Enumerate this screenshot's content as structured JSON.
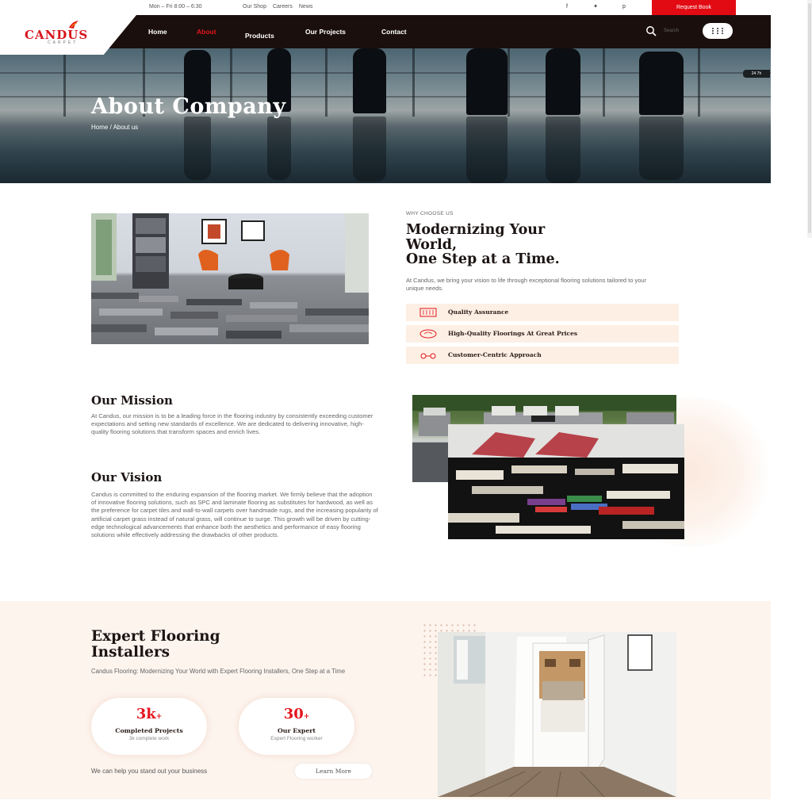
{
  "topbar": {
    "hours": "Mon – Fri 8:00 – 6:30",
    "links": [
      "Our Shop",
      "Careers",
      "News"
    ],
    "social_icons": [
      "facebook-icon",
      "twitter-icon",
      "pinterest-icon"
    ],
    "request_label": "Request Book"
  },
  "brand": {
    "name": "CANDUS",
    "tagline": "CARPET"
  },
  "nav": {
    "items": [
      "Home",
      "About",
      "Products",
      "Our Projects",
      "Contact"
    ],
    "active": "About",
    "search_placeholder": "Search"
  },
  "hero": {
    "title": "About Company",
    "breadcrumb": "Home / About us",
    "tag": "24 7h"
  },
  "why": {
    "eyebrow": "WHY CHOOSE US",
    "title_line1": "Modernizing Your",
    "title_line2": "World,",
    "title_line3": "One Step at a Time.",
    "description": "At Candus, we bring your vision to life through exceptional flooring solutions tailored to your unique needs.",
    "features": [
      {
        "label": "Quality Assurance",
        "icon": "quality-icon"
      },
      {
        "label": "High-Quality Floorings At Great Prices",
        "icon": "price-icon"
      },
      {
        "label": "Customer-Centric Approach",
        "icon": "customer-icon"
      }
    ]
  },
  "mission": {
    "title": "Our Mission",
    "text": "At Candus, our mission is to be a leading force in the flooring industry by consistently exceeding customer expectations and setting new standards of excellence. We are dedicated to delivering innovative, high-quality flooring solutions that transform spaces and enrich lives."
  },
  "vision": {
    "title": "Our Vision",
    "text": "Candus is committed to the enduring expansion of the flooring market. We firmly believe that the adoption of innovative flooring solutions, such as SPC and laminate flooring as substitutes for hardwood, as well as the preference for carpet tiles and wall-to-wall carpets over handmade rugs, and the increasing popularity of artificial carpet grass instead of natural grass, will continue to surge. This growth will be driven by cutting-edge technological advancements that enhance both the aesthetics and performance of easy flooring solutions while effectively addressing the drawbacks of other products."
  },
  "expert": {
    "title_line1": "Expert Flooring",
    "title_line2": "Installers",
    "subtitle": "Candus Flooring: Modernizing Your World with Expert Flooring Installers, One Step at a Time",
    "stats": [
      {
        "number": "3k",
        "suffix": "+",
        "label": "Completed Projects",
        "sub": "3k complete work"
      },
      {
        "number": "30",
        "suffix": "+",
        "label": "Our Expert",
        "sub": "Expert Flooring worker"
      }
    ],
    "help_text": "We can help you stand out your business",
    "cta_label": "Learn More"
  },
  "colors": {
    "accent": "#e3151d",
    "nav_bg": "#1b0f0d",
    "feature_bg": "#fdefe4",
    "section_bg": "#fdf4ee"
  }
}
